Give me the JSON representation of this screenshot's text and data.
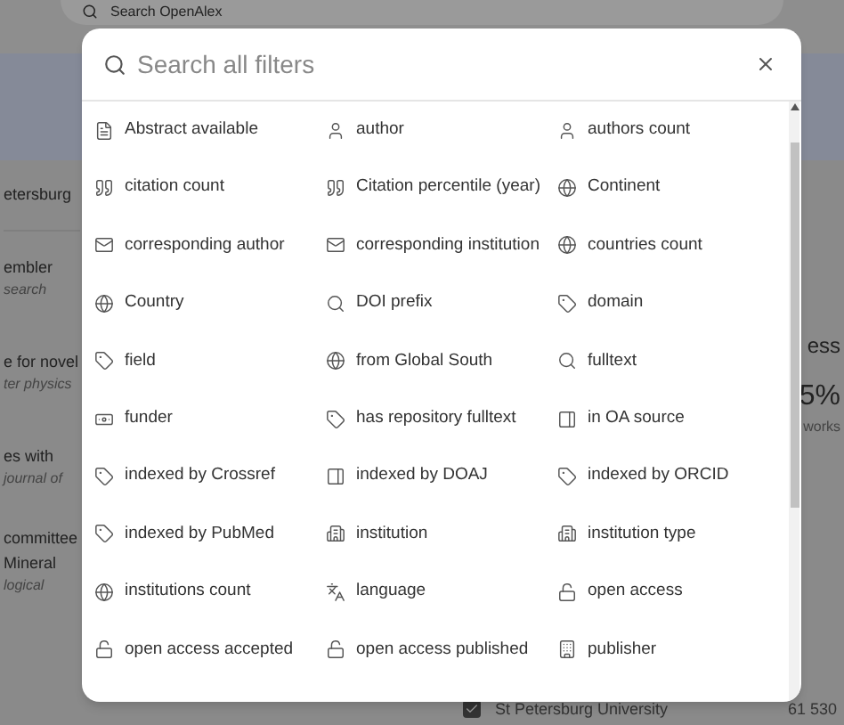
{
  "background": {
    "search": {
      "placeholder": "Search OpenAlex"
    },
    "left_snippets": [
      {
        "title": "etersburg"
      },
      {
        "title": "embler",
        "subtitle": "search"
      },
      {
        "title": "e for novel",
        "subtitle": "ter physics"
      },
      {
        "title": "es with",
        "subtitle": "journal of"
      },
      {
        "title": "committee",
        "title_2": "Mineral",
        "subtitle": "logical"
      }
    ],
    "right_card": {
      "title": "ess",
      "value": "5%",
      "caption": "works"
    },
    "bottom_row": {
      "checked": true,
      "label": "St Petersburg University",
      "count": "61 530"
    }
  },
  "dialog": {
    "search": {
      "placeholder": "Search all filters"
    },
    "filters": [
      {
        "label": "Abstract available",
        "kind": "document"
      },
      {
        "label": "author",
        "kind": "person"
      },
      {
        "label": "authors count",
        "kind": "person"
      },
      {
        "label": "citation count",
        "kind": "quote"
      },
      {
        "label": "Citation percentile (year)",
        "kind": "quote"
      },
      {
        "label": "Continent",
        "kind": "globe"
      },
      {
        "label": "corresponding author",
        "kind": "mail"
      },
      {
        "label": "corresponding institution",
        "kind": "mail"
      },
      {
        "label": "countries count",
        "kind": "globe"
      },
      {
        "label": "Country",
        "kind": "globe"
      },
      {
        "label": "DOI prefix",
        "kind": "search"
      },
      {
        "label": "domain",
        "kind": "tag"
      },
      {
        "label": "field",
        "kind": "tag"
      },
      {
        "label": "from Global South",
        "kind": "globe"
      },
      {
        "label": "fulltext",
        "kind": "search"
      },
      {
        "label": "funder",
        "kind": "money"
      },
      {
        "label": "has repository fulltext",
        "kind": "tag"
      },
      {
        "label": "in OA source",
        "kind": "panel"
      },
      {
        "label": "indexed by Crossref",
        "kind": "tag"
      },
      {
        "label": "indexed by DOAJ",
        "kind": "panel"
      },
      {
        "label": "indexed by ORCID",
        "kind": "tag"
      },
      {
        "label": "indexed by PubMed",
        "kind": "tag"
      },
      {
        "label": "institution",
        "kind": "building"
      },
      {
        "label": "institution type",
        "kind": "building"
      },
      {
        "label": "institutions count",
        "kind": "globe"
      },
      {
        "label": "language",
        "kind": "language"
      },
      {
        "label": "open access",
        "kind": "lock"
      },
      {
        "label": "open access accepted",
        "kind": "lock"
      },
      {
        "label": "open access published",
        "kind": "lock"
      },
      {
        "label": "publisher",
        "kind": "publisher"
      }
    ]
  }
}
